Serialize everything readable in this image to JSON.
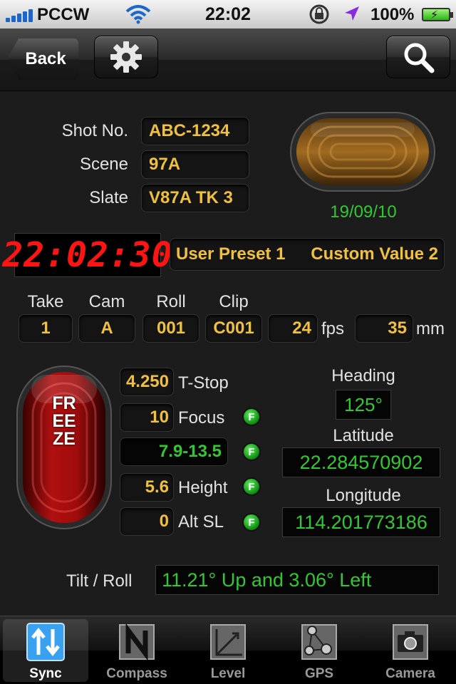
{
  "status_bar": {
    "carrier": "PCCW",
    "time": "22:02",
    "battery": "100%"
  },
  "nav": {
    "back_label": "Back",
    "settings_icon": "gear-icon",
    "search_icon": "search-icon"
  },
  "shot": {
    "shot_no_label": "Shot No.",
    "shot_no": "ABC-1234",
    "scene_label": "Scene",
    "scene": "97A",
    "slate_label": "Slate",
    "slate": "V87A TK 3",
    "date": "19/09/10"
  },
  "timecode": "22:02:30",
  "presets": {
    "left": "User Preset 1",
    "right": "Custom Value 2"
  },
  "camera": {
    "take_label": "Take",
    "take": "1",
    "cam_label": "Cam",
    "cam": "A",
    "roll_label": "Roll",
    "roll": "001",
    "clip_label": "Clip",
    "clip": "C001",
    "fps": "24",
    "fps_unit": "fps",
    "lens": "35",
    "lens_unit": "mm"
  },
  "freeze_label": "FREEZE",
  "lens_data": {
    "tstop": "4.250",
    "tstop_label": "T-Stop",
    "focus": "10",
    "focus_label": "Focus",
    "dof": "7.9-13.5",
    "height": "5.6",
    "height_label": "Height",
    "altsl": "0",
    "altsl_label": "Alt SL",
    "f_badge": "F"
  },
  "gps": {
    "heading_label": "Heading",
    "heading": "125°",
    "latitude_label": "Latitude",
    "latitude": "22.284570902",
    "longitude_label": "Longitude",
    "longitude": "114.201773186"
  },
  "tilt": {
    "label": "Tilt / Roll",
    "value": "11.21° Up and 3.06° Left"
  },
  "tabs": [
    {
      "label": "Sync",
      "icon": "sync-icon",
      "active": true
    },
    {
      "label": "Compass",
      "icon": "compass-icon",
      "active": false
    },
    {
      "label": "Level",
      "icon": "level-icon",
      "active": false
    },
    {
      "label": "GPS",
      "icon": "gps-icon",
      "active": false
    },
    {
      "label": "Camera",
      "icon": "camera-icon",
      "active": false
    }
  ],
  "colors": {
    "accent_yellow": "#f0c040",
    "gps_green": "#33c833",
    "timecode_red": "#ff1414",
    "freeze_red": "#b01010"
  }
}
